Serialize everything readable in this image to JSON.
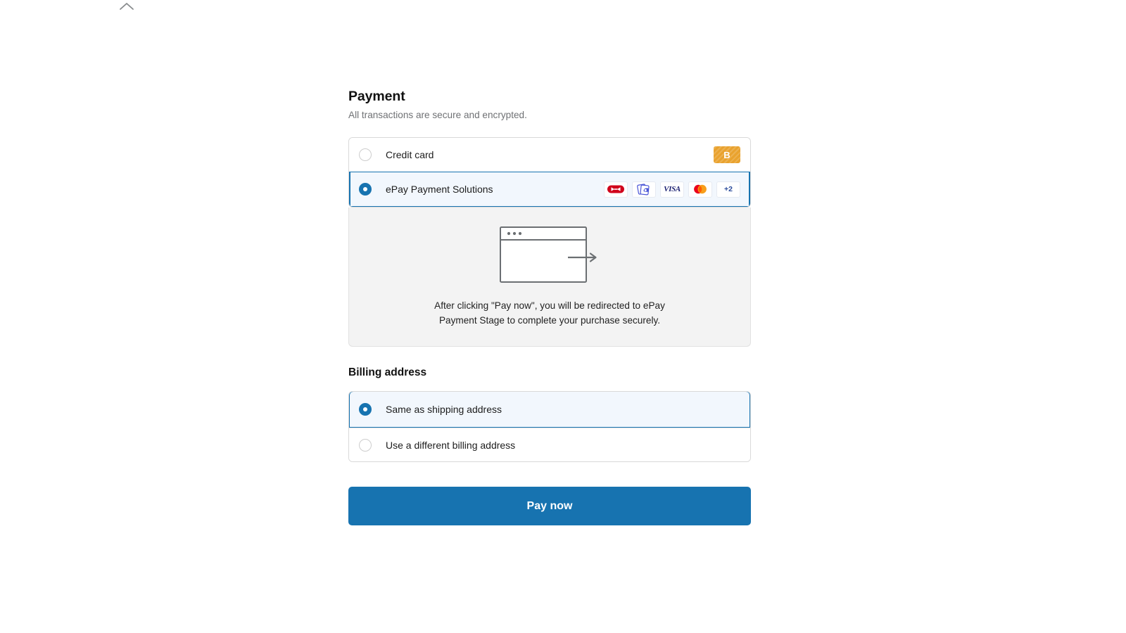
{
  "top": {
    "collapse_icon": "chevron-up-icon"
  },
  "payment": {
    "title": "Payment",
    "subtitle": "All transactions are secure and encrypted.",
    "methods": [
      {
        "id": "credit-card",
        "label": "Credit card",
        "selected": false,
        "badge": "B"
      },
      {
        "id": "epay",
        "label": "ePay Payment Solutions",
        "selected": true,
        "brands": [
          {
            "name": "dankort-icon",
            "text": ""
          },
          {
            "name": "mobilepay-icon",
            "text": ""
          },
          {
            "name": "visa-icon",
            "text": "VISA"
          },
          {
            "name": "mastercard-icon",
            "text": ""
          }
        ],
        "more_label": "+2"
      }
    ],
    "redirect": {
      "illustration": "browser-redirect-icon",
      "text": "After clicking \"Pay now\", you will be redirected to ePay Payment Stage to complete your purchase securely."
    }
  },
  "billing": {
    "title": "Billing address",
    "options": [
      {
        "id": "same-as-shipping",
        "label": "Same as shipping address",
        "selected": true
      },
      {
        "id": "different-billing",
        "label": "Use a different billing address",
        "selected": false
      }
    ]
  },
  "actions": {
    "pay_now_label": "Pay now"
  },
  "colors": {
    "accent": "#1773b0",
    "selected_bg": "#f2f7fd",
    "panel_bg": "#f3f3f3",
    "badge_orange": "#e9a22e",
    "visa_blue": "#1a1f71",
    "mastercard_red": "#eb001b",
    "mastercard_orange": "#f79e1b",
    "dankort_red": "#d0021b"
  }
}
